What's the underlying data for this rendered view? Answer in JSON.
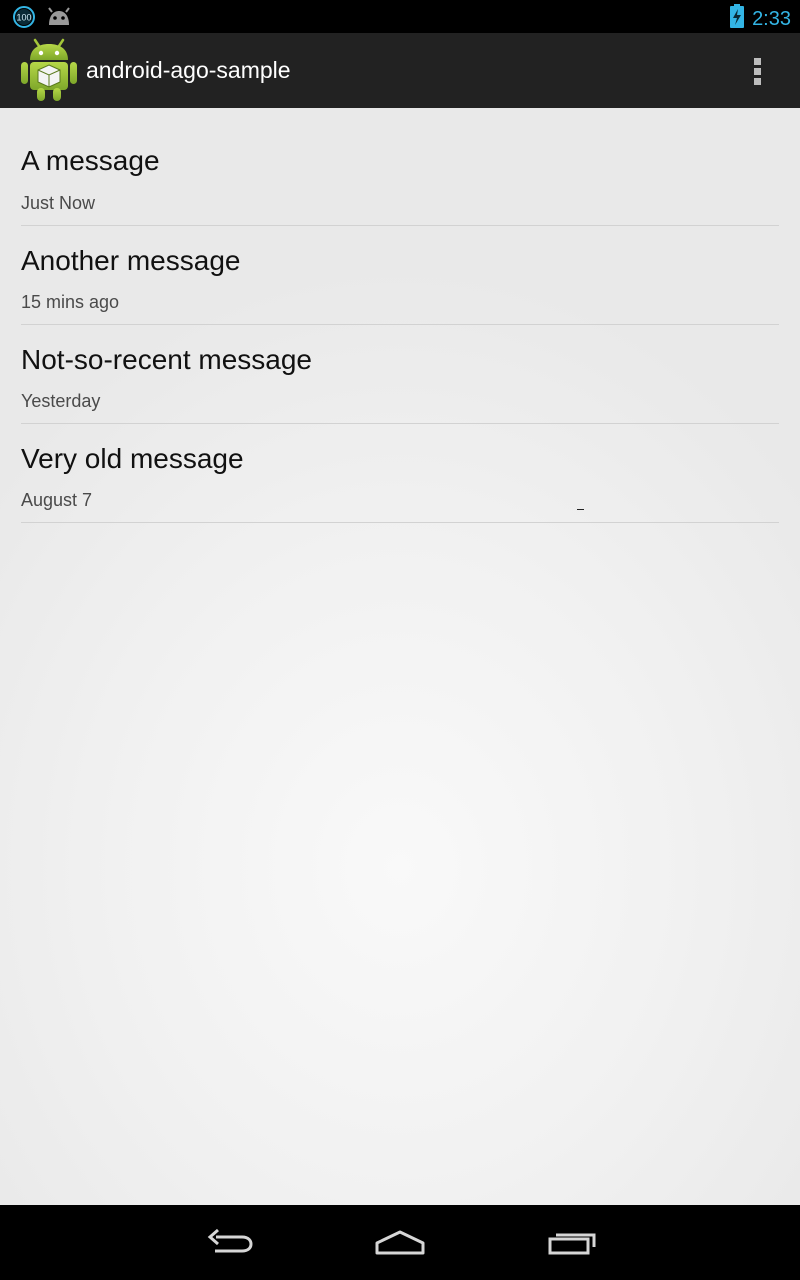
{
  "status_bar": {
    "notification_badge": "100",
    "time": "2:33",
    "accent_color": "#33b5e5"
  },
  "action_bar": {
    "title": "android-ago-sample",
    "icon": "android-robot-icon",
    "overflow_icon": "overflow-menu-icon"
  },
  "messages": [
    {
      "title": "A message",
      "time_ago": "Just Now"
    },
    {
      "title": "Another message",
      "time_ago": "15 mins ago"
    },
    {
      "title": "Not-so-recent message",
      "time_ago": "Yesterday"
    },
    {
      "title": "Very old message",
      "time_ago": "August 7"
    }
  ],
  "nav_bar": {
    "back_icon": "back-icon",
    "home_icon": "home-icon",
    "recents_icon": "recent-apps-icon"
  }
}
